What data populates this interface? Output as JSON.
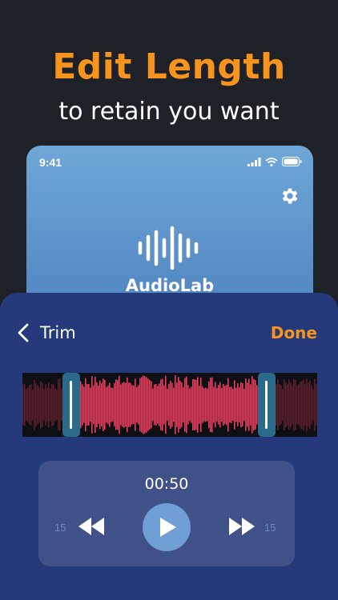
{
  "promo": {
    "headline": "Edit Length",
    "subheadline": "to retain you want"
  },
  "phone": {
    "status_time": "9:41",
    "app_name": "AudioLab",
    "icons": [
      "signal-icon",
      "wifi-icon",
      "battery-icon",
      "gear-icon",
      "waveform-logo-icon"
    ]
  },
  "trim_sheet": {
    "title": "Trim",
    "done_label": "Done",
    "back_icon": "chevron-left-icon"
  },
  "player": {
    "time": "00:50",
    "rewind_seconds": "15",
    "forward_seconds": "15",
    "icons": [
      "rewind-icon",
      "play-icon",
      "fast-forward-icon"
    ]
  },
  "colors": {
    "accent": "#f7941d",
    "background": "#1e2228",
    "sheet": "#243a7a",
    "waveform_selected": "#e63e5c",
    "waveform_unselected": "#5a1f2a",
    "handle": "#2b6a8a"
  }
}
